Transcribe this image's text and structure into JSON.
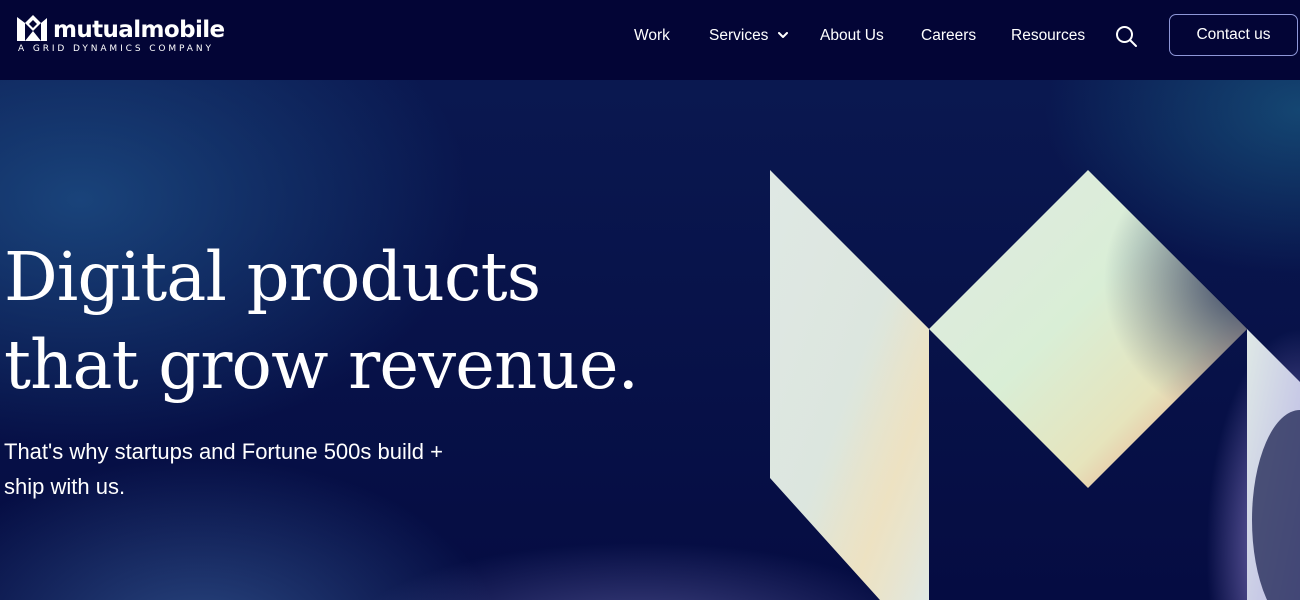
{
  "brand": {
    "wordmark": "mutualmobile",
    "tagline": "A GRID DYNAMICS COMPANY",
    "logo_icon": "mutualmobile-logo-mark"
  },
  "nav": {
    "items": [
      {
        "label": "Work"
      },
      {
        "label": "Services",
        "has_dropdown": true,
        "icon": "chevron-down-icon"
      },
      {
        "label": "About Us"
      },
      {
        "label": "Careers"
      },
      {
        "label": "Resources"
      }
    ],
    "search_icon": "search-icon",
    "contact_label": "Contact us"
  },
  "hero": {
    "headline_line1": "Digital products",
    "headline_line2": "that grow revenue.",
    "subtext": "That's why startups and Fortune 500s build + ship with us."
  },
  "colors": {
    "header_bg": "#030536",
    "hero_bg": "#050c42",
    "text": "#ffffff",
    "button_border": "#8e97d8"
  }
}
